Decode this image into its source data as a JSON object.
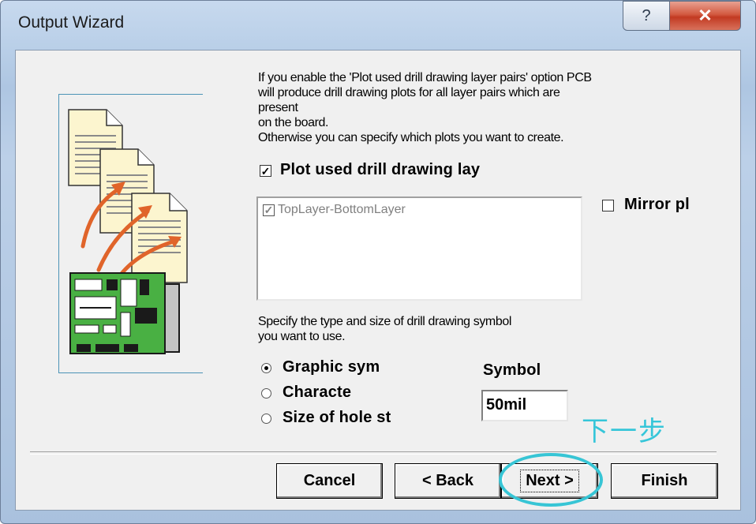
{
  "window": {
    "title": "Output Wizard",
    "help_glyph": "?",
    "close_glyph": "✕"
  },
  "description": {
    "lines": [
      "If you enable the 'Plot used drill drawing layer pairs' option PCB",
      "will produce drill drawing plots for all layer pairs which are",
      "present",
      "on the board.",
      "Otherwise you can specify which plots you want to create."
    ]
  },
  "plot_used": {
    "label": "Plot used drill drawing lay",
    "checked": true
  },
  "layer_pairs": {
    "items": [
      {
        "label": "TopLayer-BottomLayer",
        "checked": true
      }
    ]
  },
  "mirror": {
    "label": "Mirror pl",
    "checked": false
  },
  "symbol_spec": {
    "lines": [
      "Specify the type and size of drill drawing symbol",
      "you want to use."
    ]
  },
  "symbol_type": {
    "options": [
      {
        "label": "Graphic sym",
        "selected": true
      },
      {
        "label": "Characte",
        "selected": false
      },
      {
        "label": "Size of hole st",
        "selected": false
      }
    ]
  },
  "symbol_size": {
    "label": "Symbol",
    "value": "50mil"
  },
  "annotation": {
    "text": "下一步",
    "color": "#36c6d9"
  },
  "buttons": {
    "cancel": "Cancel",
    "back": "< Back",
    "next": "Next >",
    "finish": "Finish"
  },
  "icons": {
    "art": "documents-to-circuit-board-illustration",
    "help": "help-icon",
    "close": "close-icon"
  }
}
